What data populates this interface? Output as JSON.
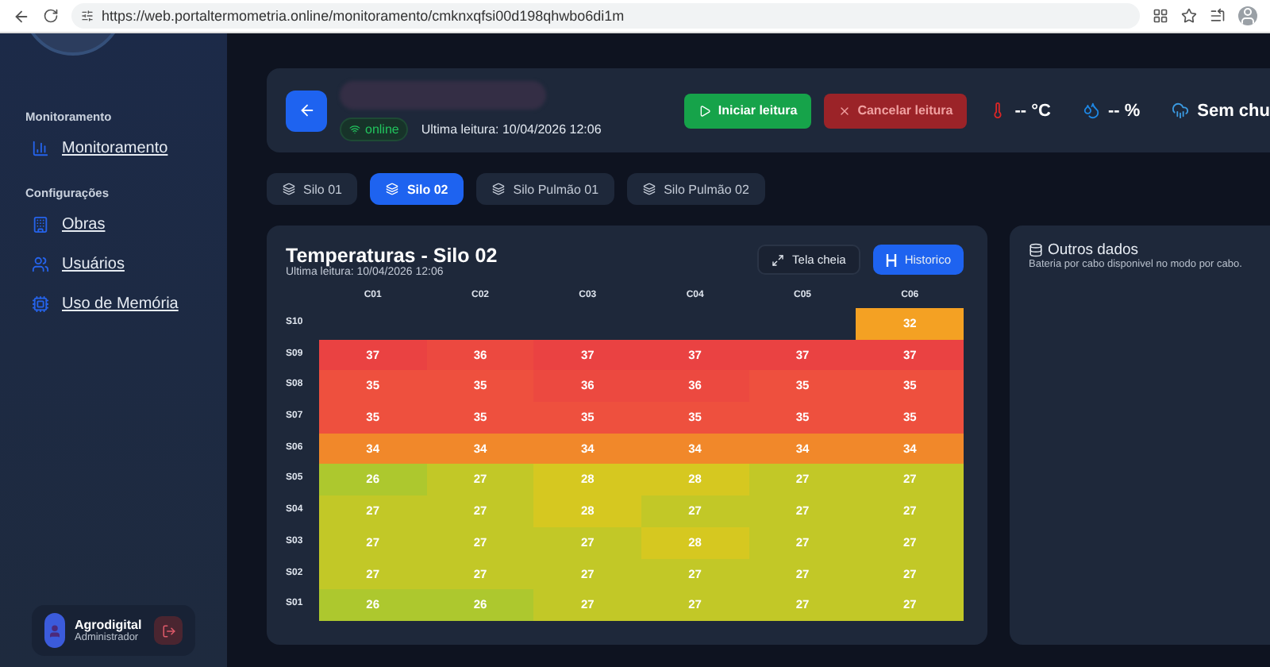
{
  "browser": {
    "url": "https://web.portaltermometria.online/monitoramento/cmknxqfsi00d198qhwbo6di1m"
  },
  "sidebar": {
    "sections": [
      {
        "title": "Monitoramento",
        "items": [
          {
            "label": "Monitoramento",
            "kind": "chart"
          }
        ]
      },
      {
        "title": "Configurações",
        "items": [
          {
            "label": "Obras",
            "kind": "building"
          },
          {
            "label": "Usuários",
            "kind": "users"
          },
          {
            "label": "Uso de Memória",
            "kind": "chip"
          }
        ]
      }
    ],
    "user": {
      "name": "Agrodigital",
      "role": "Administrador"
    }
  },
  "header": {
    "status": "online",
    "last_reading": "Ultima leitura: 10/04/2026 12:06",
    "buttons": [
      {
        "label": "Iniciar leitura",
        "kind": "start"
      },
      {
        "label": "Cancelar leitura",
        "kind": "cancel"
      }
    ],
    "readings": [
      {
        "kind": "temperature",
        "value": "-- °C"
      },
      {
        "kind": "humidity",
        "value": "-- %"
      },
      {
        "kind": "rain",
        "value": "Sem chu"
      }
    ]
  },
  "tabs": [
    {
      "label": "Silo 01",
      "selected": false
    },
    {
      "label": "Silo 02",
      "selected": true
    },
    {
      "label": "Silo Pulmão 01",
      "selected": false
    },
    {
      "label": "Silo Pulmão 02",
      "selected": false
    }
  ],
  "heatmap": {
    "title": "Temperaturas - Silo 02",
    "subtitle": "Ultima leitura: 10/04/2026 12:06",
    "buttons": [
      {
        "label": "Tela cheia",
        "kind": "fullscreen"
      },
      {
        "label": "Historico",
        "kind": "history"
      }
    ],
    "columns": [
      "C01",
      "C02",
      "C03",
      "C04",
      "C05",
      "C06"
    ],
    "rows": [
      {
        "label": "S10",
        "cells": [
          null,
          null,
          null,
          null,
          null,
          "32"
        ]
      },
      {
        "label": "S09",
        "cells": [
          "37",
          "36",
          "37",
          "37",
          "37",
          "37"
        ]
      },
      {
        "label": "S08",
        "cells": [
          "35",
          "35",
          "36",
          "36",
          "35",
          "35"
        ]
      },
      {
        "label": "S07",
        "cells": [
          "35",
          "35",
          "35",
          "35",
          "35",
          "35"
        ]
      },
      {
        "label": "S06",
        "cells": [
          "34",
          "34",
          "34",
          "34",
          "34",
          "34"
        ]
      },
      {
        "label": "S05",
        "cells": [
          "26",
          "27",
          "28",
          "28",
          "27",
          "27"
        ]
      },
      {
        "label": "S04",
        "cells": [
          "27",
          "27",
          "28",
          "27",
          "27",
          "27"
        ]
      },
      {
        "label": "S03",
        "cells": [
          "27",
          "27",
          "27",
          "28",
          "27",
          "27"
        ]
      },
      {
        "label": "S02",
        "cells": [
          "27",
          "27",
          "27",
          "27",
          "27",
          "27"
        ]
      },
      {
        "label": "S01",
        "cells": [
          "26",
          "26",
          "27",
          "27",
          "27",
          "27"
        ]
      }
    ]
  },
  "other": {
    "title": "Outros dados",
    "text": "Bateria por cabo disponivel no modo por cabo."
  }
}
